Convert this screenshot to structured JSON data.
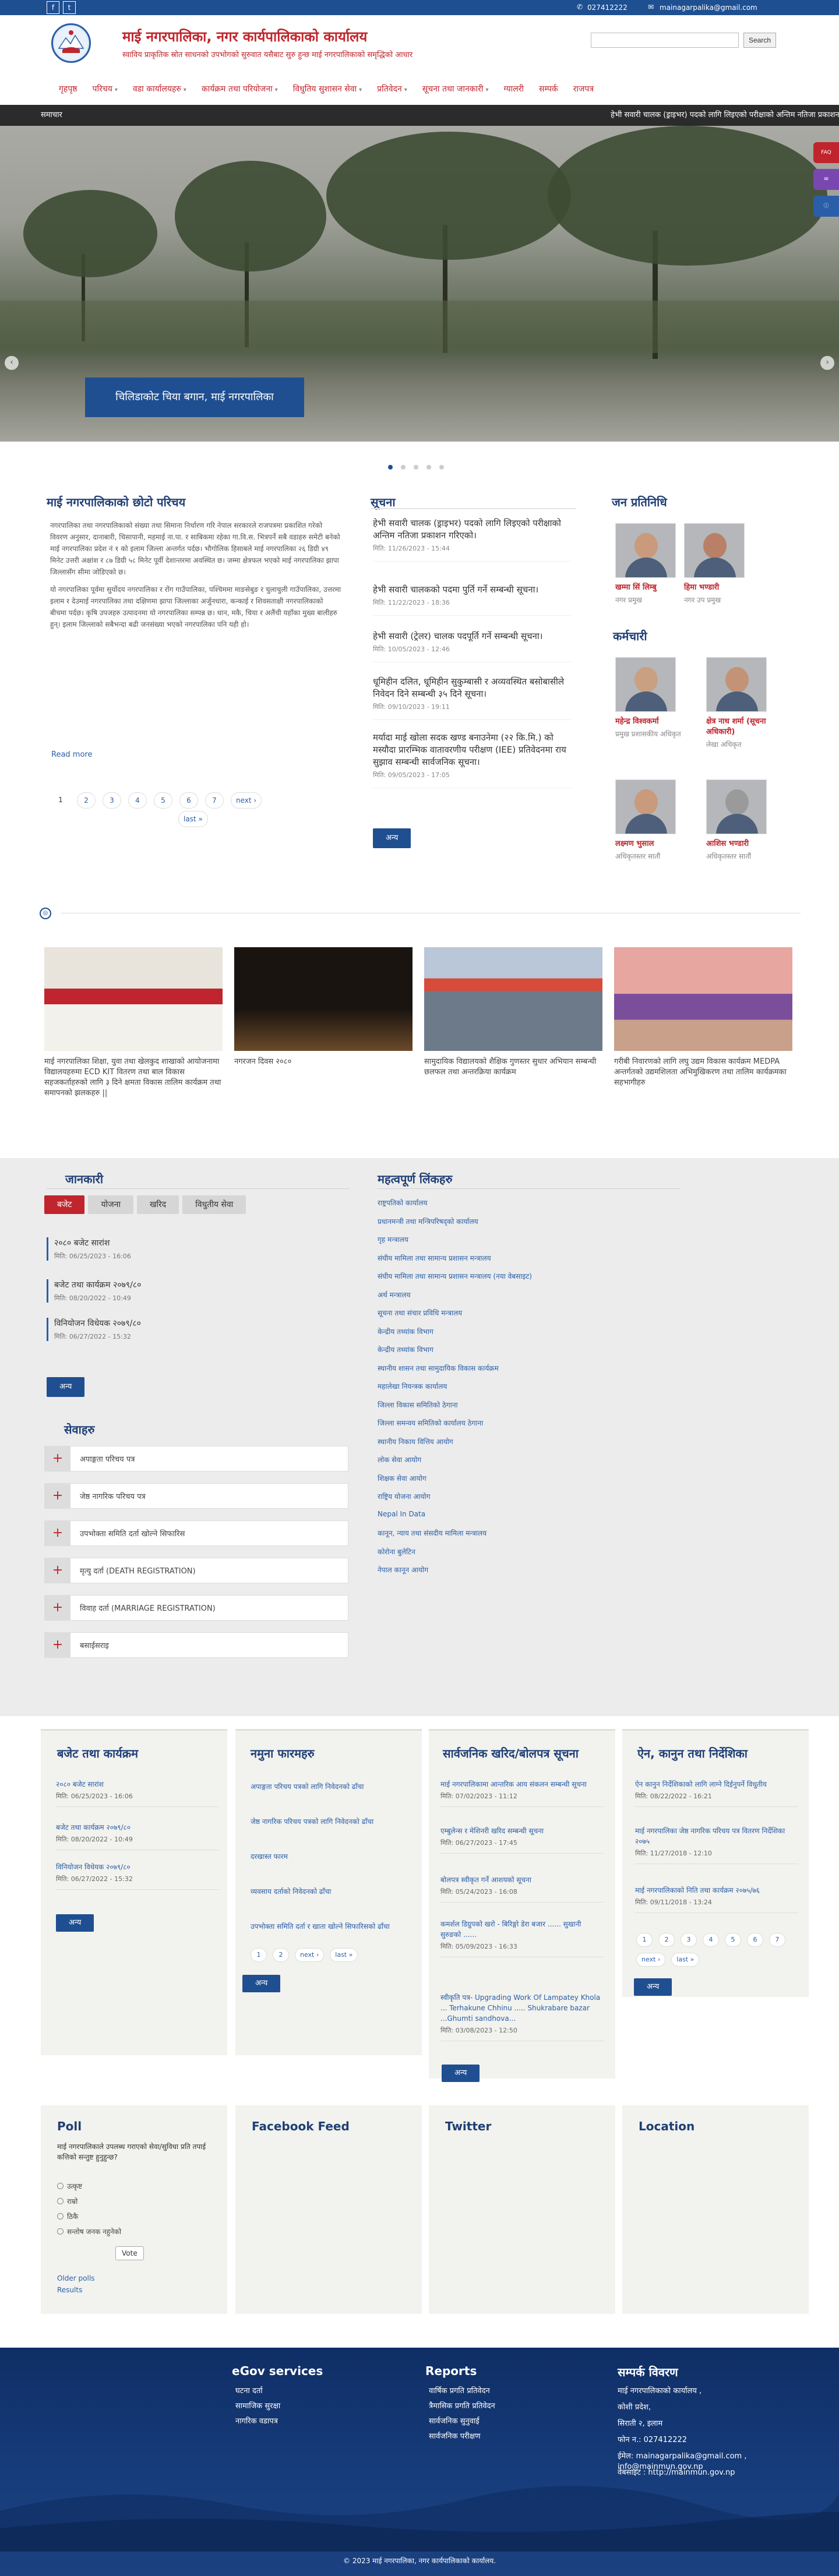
{
  "topbar": {
    "phone": "027412222",
    "email": "mainagarpalika@gmail.com"
  },
  "header": {
    "title": "माई नगरपालिका, नगर कार्यपालिकाको कार्यालय",
    "tagline": "स्वाविय प्राकृतिक स्रोत साधनको उपभोगको सुरुवात यसैबाट सुरु हुन्छ माई नगरपालिकाको समृद्धिको आधार",
    "search_placeholder": "",
    "search_button": "Search"
  },
  "nav": [
    {
      "label": "गृहपृष्ठ",
      "caret": false
    },
    {
      "label": "परिचय",
      "caret": true
    },
    {
      "label": "वडा कार्यालयहरु",
      "caret": true
    },
    {
      "label": "कार्यक्रम तथा परियोजना",
      "caret": true
    },
    {
      "label": "विधुतिय सुशासन सेवा",
      "caret": true
    },
    {
      "label": "प्रतिवेदन",
      "caret": true
    },
    {
      "label": "सूचना तथा जानकारी",
      "caret": true
    },
    {
      "label": "ग्यालरी",
      "caret": false
    },
    {
      "label": "सम्पर्क",
      "caret": false
    },
    {
      "label": "राजपत्र",
      "caret": false
    }
  ],
  "ticker": {
    "label": "समाचार",
    "text": "हेभी सवारी चालक (ड्राइभर) पदको लागि लिइएको परीक्षाको अन्तिम नतिजा प्रकाशन गरिएको।"
  },
  "slider": {
    "caption": "चिलिडाकोट चिया बगान, माई नगरपालिका"
  },
  "intro": {
    "title": "माई नगरपालिकाको छोटो परिचय",
    "paragraph1": "नगरपालिका तथा नगरपालिकाको संख्या तथा सिमाना निर्धारण गरि नेपाल सरकारले राजपत्रमा प्रकाशित गरेको विवरण अनुसार, दानाबारी, चिसापानी, महमाई ना.पा. र साबिकमा रहेका गा.वि.स. भित्रपर्ने सबै वडाहरु समेटी बनेको माई नगरपालिका प्रदेश नं १ को इलाम जिल्ला अन्तर्गत पर्दछ। भौगोलिक हिसाबले माई नगरपालिका २६ डिग्री ४९ मिनेट उत्तरी अक्षांश र ८७ डिग्री ५८ मिनेट पूर्वी देशान्तरमा अवस्थित छ। जम्मा क्षेत्रफल भएको माई नगरपालिका झापा जिल्लासँग सीमा जोडिएको छ।",
    "paragraph2": "यो नगरपालिका पूर्वमा सुर्योदय नगरपालिका र रोंग गाउँपालिका, पश्चिममा माङसेबुङ र चुलाचुली गाउँपालिका, उत्तरमा इलाम र देउमाई नगरपालिका तथा दक्षिणमा झापा जिल्लाका अर्जुनधारा, कन्काई र शिवसताक्षी नगरपालिकाको बीचमा पर्दछ। कृषि उपजहरु उत्पादनमा यो नगरपालिका सम्पन्न छ। धान, मकै, चिया र अलैंची यहाँका मुख्य बालीहरु हुन्। इलाम जिल्लाको सबैभन्दा बढी जनसंख्या भएको नगरपालिका पनि यही हो।",
    "read_more": "Read more",
    "pages": [
      "1",
      "2",
      "3",
      "4",
      "5",
      "6",
      "7"
    ],
    "next": "next ›",
    "last": "last »"
  },
  "notices": {
    "title": "सूचना",
    "items": [
      {
        "title": "हेभी सवारी चालक (ड्राइभर) पदको लागि लिइएको परीक्षाको अन्तिम नतिजा प्रकाशन गरिएको।",
        "date": "मिति: 11/26/2023 - 15:44"
      },
      {
        "title": "हेभी सवारी चालकको पदमा पुर्ति गर्ने सम्बन्धी सूचना।",
        "date": "मिति: 11/22/2023 - 18:36"
      },
      {
        "title": "हेभी सवारी (ट्रेलर) चालक पदपूर्ति गर्ने सम्बन्धी सूचना।",
        "date": "मिति: 10/05/2023 - 12:46"
      },
      {
        "title": "धूमिहीन दलित, धूमिहीन सुकुम्बासी र अव्यवस्थित बसोबासीले निवेदन दिने सम्बन्धी ३५ दिने सूचना।",
        "date": "मिति: 09/10/2023 - 19:11"
      },
      {
        "title": "मर्यादा माई खोला सदक खण्ड बनाउनेमा (२२ कि.मि.) को मस्यौदा प्रारम्भिक वातावरणीय परीक्षण (IEE) प्रतिवेदनमा राय सुझाव सम्बन्धी सार्वजनिक सूचना।",
        "date": "मिति: 09/05/2023 - 17:05"
      }
    ],
    "more": "अन्य"
  },
  "representatives": {
    "title": "जन प्रतिनिधि",
    "people": [
      {
        "name": "खम्मा सिं लिम्बु",
        "role": "नगर प्रमुख"
      },
      {
        "name": "हिमा भण्डारी",
        "role": "नगर उप प्रमुख"
      }
    ]
  },
  "staff": {
    "title": "कर्मचारी",
    "people": [
      {
        "name": "महेन्द्र विश्वकर्मा",
        "role": "प्रमुख प्रशासकीय अधिकृत"
      },
      {
        "name": "क्षेत्र नाथ शर्मा (सूचना अधिकारी)",
        "role": "लेखा अधिकृत"
      },
      {
        "name": "लक्ष्मण भुसाल",
        "role": "अधिकृतस्तर सातौं"
      },
      {
        "name": "आशिस भण्डारी",
        "role": "अधिकृतस्तर सातौं"
      }
    ]
  },
  "gallery": [
    {
      "caption": "माई नगरपालिका शिक्षा, युवा तथा खेलकुद शाखाको आयोजनामा विद्यालयहरुमा ECD KIT वितरण तथा बाल विकास सहजकर्ताहरुको लागि ३ दिने क्षमता विकास तालिम कार्यक्रम तथा समापनको झलकहरु ||"
    },
    {
      "caption": "नगरजन दिवस २०८०"
    },
    {
      "caption": "सामुदायिक विद्यालयको शैक्षिक गुणस्तर सुधार अभियान सम्बन्धी छलफल तथा अन्तरक्रिया कार्यक्रम"
    },
    {
      "caption": "गरीबी निवारणको लागि लघु उद्यम विकास कार्यक्रम MEDPA अन्तर्गतको उद्यमशिलता अभिमुखिकरण तथा तालिम कार्यक्रमका सहभागीहरु"
    }
  ],
  "info": {
    "title": "जानकारी",
    "tabs": [
      "बजेट",
      "योजना",
      "खरिद",
      "विधुतीय सेवा"
    ],
    "items": [
      {
        "title": "२०८० बजेट सारांश",
        "date": "मिति: 06/25/2023 - 16:06"
      },
      {
        "title": "बजेट तथा कार्यक्रम २०७९/८०",
        "date": "मिति: 08/20/2022 - 10:49"
      },
      {
        "title": "विनियोजन विधेयक २०७९/८०",
        "date": "मिति: 06/27/2022 - 15:32"
      }
    ],
    "more": "अन्य"
  },
  "services": {
    "title": "सेवाहरु",
    "items": [
      "अपाङ्गता परिचय पत्र",
      "जेष्ठ नागरिक परिचय पत्र",
      "उपभोक्ता समिति दर्ता खोल्ने सिफारिस",
      "मृत्यु दर्ता (DEATH REGISTRATION)",
      "विवाह दर्ता (MARRIAGE REGISTRATION)",
      "बसाईसराइ"
    ]
  },
  "important_links": {
    "title": "महत्वपूर्ण लिंकहरु",
    "items": [
      "राष्ट्रपतिको कार्यालय",
      "प्रधानमन्त्री तथा मन्त्रिपरिषद्को कार्यालय",
      "गृह मन्त्रालय",
      "संघीय मामिला तथा सामान्य प्रशासन मन्त्रालय",
      "संघीय मामिला तथा सामान्य प्रशासन मन्त्रालय (नया वेबसाइट)",
      "अर्थ मन्त्रालय",
      "सूचना तथा संचार प्रविधि मन्त्रालय",
      "केन्द्रीय तथ्यांक विभाग",
      "केन्द्रीय तथ्यांक विभाग",
      "स्थानीय शासन तथा सामुदायिक विकास कार्यक्रम",
      "महालेखा नियन्त्रक कार्यालय",
      "जिल्ला विकास समितिको ठेगाना",
      "जिल्ला समन्वय समितिको कार्यालय ठेगाना",
      "स्थानीय निकाय वित्तिय आयोग",
      "लोक सेवा आयोग",
      "शिक्षक सेवा आयोग",
      "राष्ट्रिय योजना आयोग",
      "Nepal In Data",
      "कानून, न्याय तथा संसदीय मामिला मन्त्रालय",
      "कोरोना बुलेटिन",
      "नेपाल कानून आयोग"
    ]
  },
  "budget_col": {
    "title": "बजेट तथा कार्यक्रम",
    "items": [
      {
        "title": "२०८० बजेट सारांश",
        "date": "मिति: 06/25/2023 - 16:06"
      },
      {
        "title": "बजेट तथा कार्यक्रम २०७९/८०",
        "date": "मिति: 08/20/2022 - 10:49"
      },
      {
        "title": "विनियोजन विधेयक २०७९/८०",
        "date": "मिति: 06/27/2022 - 15:32"
      }
    ],
    "more": "अन्य"
  },
  "forms_col": {
    "title": "नमुना फारमहरु",
    "items": [
      "अपाङ्गता परिचय पत्रको लागि निवेदनको ढाँचा",
      "जेष्ठ नागरिक परिचय पत्रको लागि निवेदनको ढाँचा",
      "दरखास्त फारम",
      "व्यवसाय दर्ताको निवेदनको ढाँचा",
      "उपभोक्ता समिति दर्ता र खाता खोल्ने सिफारिसको ढाँचा"
    ],
    "pages": [
      "1",
      "2"
    ],
    "next": "next ›",
    "last": "last »",
    "more": "अन्य"
  },
  "procurement_col": {
    "title": "सार्वजनिक खरिद/बोलपत्र सूचना",
    "items": [
      {
        "title": "माई नगरपालिकामा आन्तरिक आय संकलन सम्बन्धी सूचना",
        "date": "मिति: 07/02/2023 - 11:12"
      },
      {
        "title": "एम्बुलेन्स र मेशिनरी खरिद सम्बन्धी सूचना",
        "date": "मिति: 06/27/2023 - 17:45"
      },
      {
        "title": "बोलपत्र स्वीकृत गर्ने आशयको सूचना",
        "date": "मिति: 05/24/2023 - 16:08"
      },
      {
        "title": "कमर्शल डिग्रुपको खरो - बिरिङ्गो डेरा बजार ...... सुखानी सुरुङको ......",
        "date": "मिति: 05/09/2023 - 16:33"
      },
      {
        "title": "स्वीकृति पत्र- Upgrading Work Of Lampatey Khola ... Terhakune Chhinu ..... Shukrabare bazar ...Ghumti sandhova...",
        "date": "मिति: 03/08/2023 - 12:50"
      }
    ],
    "more": "अन्य"
  },
  "laws_col": {
    "title": "ऐन, कानुन तथा निर्देशिका",
    "items": [
      {
        "title": "ऐन कानुन निर्देशिकाको लागि लाग्ने दिईनुपर्ने विधुतीय",
        "date": "मिति: 08/22/2022 - 16:21"
      },
      {
        "title": "माई नगरपालिका जेष्ठ नागरिक परिचय पत्र वितरण निर्देशिका २०७५",
        "date": "मिति: 11/27/2018 - 12:10"
      },
      {
        "title": "माई नगरपालिकाको निति तथा कार्यक्रम २०७५/७६",
        "date": "मिति: 09/11/2018 - 13:24"
      }
    ],
    "pages": [
      "1",
      "2",
      "3",
      "4",
      "5",
      "6",
      "7"
    ],
    "next": "next ›",
    "last": "last »",
    "more": "अन्य"
  },
  "poll": {
    "title": "Poll",
    "question": "माई नगरपालिकाले उपलब्ध गराएको सेवा/सुविधा प्रति तपाई कत्तिको सन्तुष्ट हुनुहुन्छ?",
    "options": [
      "उत्कृष्ट",
      "राम्रो",
      "ठिकै",
      "सन्तोष जनक नहुनेको"
    ],
    "vote": "Vote",
    "older": "Older polls",
    "results": "Results"
  },
  "widgets": {
    "facebook": "Facebook Feed",
    "twitter": "Twitter",
    "location": "Location"
  },
  "footer": {
    "egov_title": "eGov services",
    "egov_links": [
      "घटना दर्ता",
      "सामाजिक सुरक्षा",
      "नागरिक वडापत्र"
    ],
    "reports_title": "Reports",
    "reports_links": [
      "वार्षिक प्रगति प्रतिवेदन",
      "त्रैमासिक प्रगति प्रतिवेदन",
      "सार्वजनिक सुनुवाई",
      "सार्वजनिक परीक्षण"
    ],
    "contact_title": "सम्पर्क विवरण",
    "contact_lines": [
      "माई नगरपालिकाको कार्यालय ,",
      "कोशी प्रदेश,",
      "सिराती २, इलाम",
      "फोन न.: 027412222",
      "ईमेल: mainagarpalika@gmail.com , info@mainmun.gov.np",
      "वेबसाइट : http://mainmun.gov.np"
    ],
    "copyright": "© 2023 माई नगरपालिका, नगर कार्यपालिकाको कार्यालय."
  }
}
